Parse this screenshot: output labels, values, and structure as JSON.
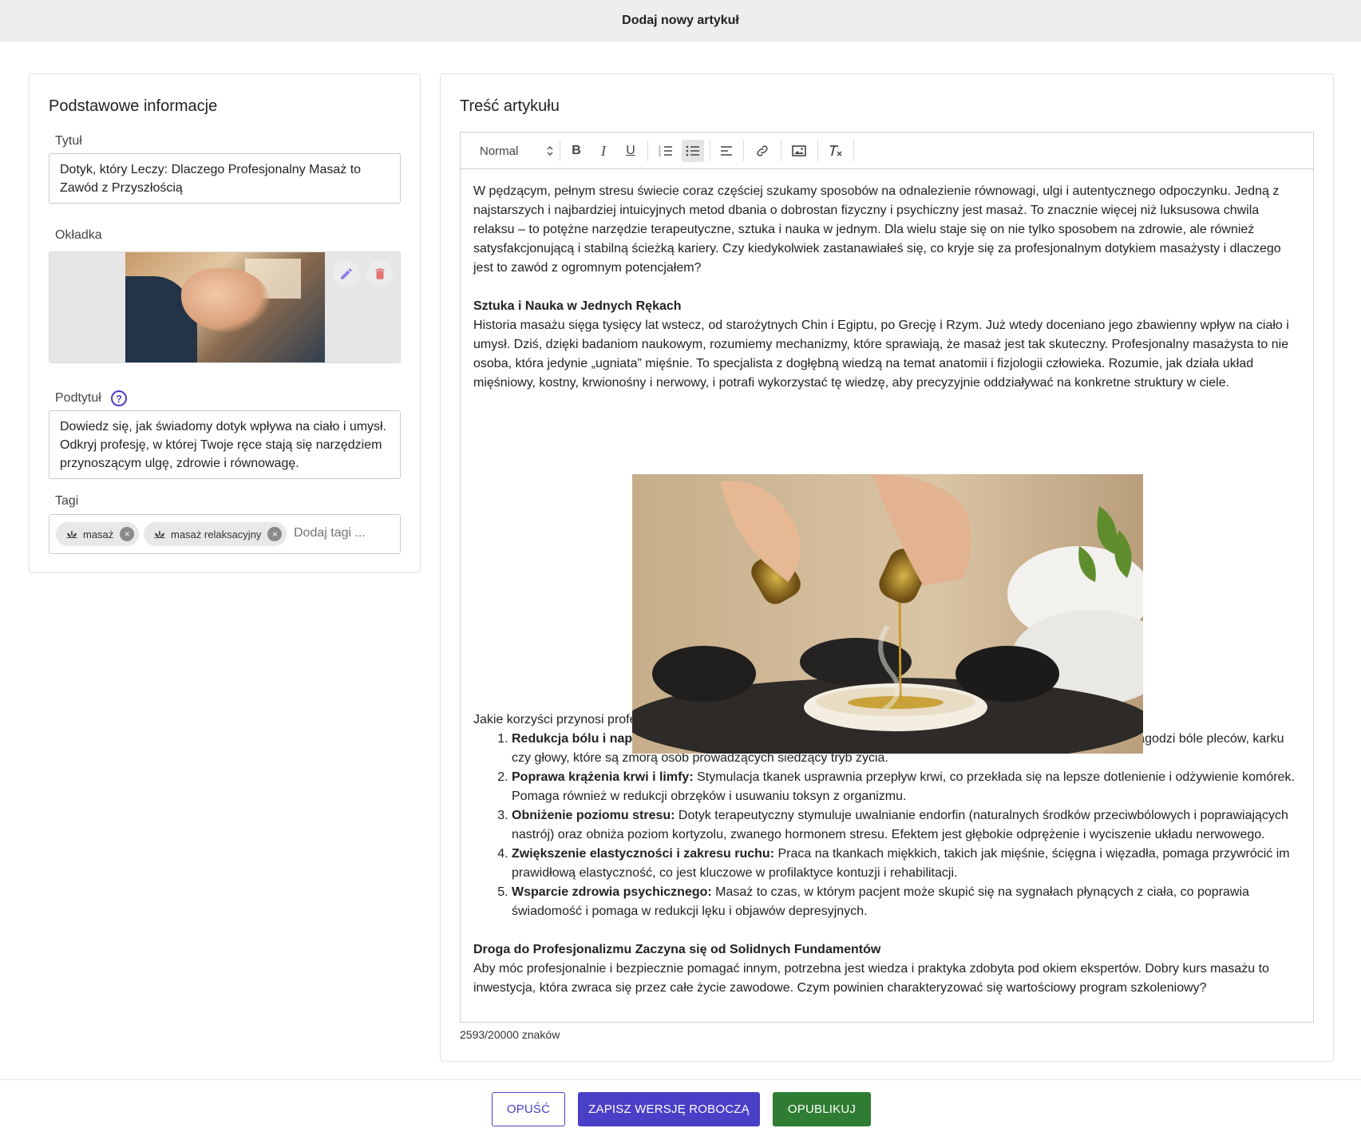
{
  "header": {
    "title": "Dodaj nowy artykuł"
  },
  "basic_info": {
    "section_title": "Podstawowe informacje",
    "title_label": "Tytuł",
    "title_value": "Dotyk, który Leczy: Dlaczego Profesjonalny Masaż to Zawód z Przyszłością",
    "cover_label": "Okładka",
    "cover_actions": {
      "edit_icon": "pencil-icon",
      "delete_icon": "trash-icon"
    },
    "subtitle_label": "Podtytuł",
    "subtitle_help_icon": "question-circle-icon",
    "subtitle_value": "Dowiedz się, jak świadomy dotyk wpływa na ciało i umysł. Odkryj profesję, w której Twoje ręce stają się narzędziem przynoszącym ulgę, zdrowie i równowagę.",
    "tags_label": "Tagi",
    "tags": [
      {
        "label": "masaż",
        "icon": "lotus-icon"
      },
      {
        "label": "masaż relaksacyjny",
        "icon": "lotus-icon"
      }
    ],
    "tags_placeholder": "Dodaj tagi ..."
  },
  "article": {
    "section_title": "Treść artykułu",
    "toolbar": {
      "format_select": "Normal",
      "buttons": [
        "bold-icon",
        "italic-icon",
        "underline-icon",
        "ordered-list-icon",
        "bullet-list-icon",
        "align-icon",
        "link-icon",
        "image-icon",
        "clear-format-icon"
      ],
      "active_button": "bullet-list-icon",
      "bold_label": "B",
      "italic_label": "I",
      "underline_label": "U"
    },
    "intro": "W pędzącym, pełnym stresu świecie coraz częściej szukamy sposobów na odnalezienie równowagi, ulgi i autentycznego odpoczynku. Jedną z najstarszych i najbardziej intuicyjnych metod dbania o dobrostan fizyczny i psychiczny jest masaż. To znacznie więcej niż luksusowa chwila relaksu – to potężne narzędzie terapeutyczne, sztuka i nauka w jednym. Dla wielu staje się on nie tylko sposobem na zdrowie, ale również satysfakcjonującą i stabilną ścieżką kariery. Czy kiedykolwiek zastanawiałeś się, co kryje się za profesjonalnym dotykiem masażysty i dlaczego jest to zawód z ogromnym potencjałem?",
    "heading1": "Sztuka i Nauka w Jednych Rękach",
    "para1": "Historia masażu sięga tysięcy lat wstecz, od starożytnych Chin i Egiptu, po Grecję i Rzym. Już wtedy doceniano jego zbawienny wpływ na ciało i umysł. Dziś, dzięki badaniom naukowym, rozumiemy mechanizmy, które sprawiają, że masaż jest tak skuteczny. Profesjonalny masażysta to nie osoba, która jedynie „ugniata” mięśnie. To specjalista z dogłębną wiedzą na temat anatomii i fizjologii człowieka. Rozumie, jak działa układ mięśniowy, kostny, krwionośny i nerwowy, i potrafi wykorzystać tę wiedzę, aby precyzyjnie oddziaływać na konkretne struktury w ciele.",
    "benefits_intro": "Jakie korzyści przynosi profesjonalnie wykonany masaż?",
    "benefits": [
      {
        "title": "Redukcja bólu i napięcia mięśniowego:",
        "text": " Poprzez rozluźnianie przykurczonych włókien mięśniowych, masaż łagodzi bóle pleców, karku czy głowy, które są zmorą osób prowadzących siedzący tryb życia."
      },
      {
        "title": "Poprawa krążenia krwi i limfy:",
        "text": " Stymulacja tkanek usprawnia przepływ krwi, co przekłada się na lepsze dotlenienie i odżywienie komórek. Pomaga również w redukcji obrzęków i usuwaniu toksyn z organizmu."
      },
      {
        "title": "Obniżenie poziomu stresu:",
        "text": " Dotyk terapeutyczny stymuluje uwalnianie endorfin (naturalnych środków przeciwbólowych i poprawiających nastrój) oraz obniża poziom kortyzolu, zwanego hormonem stresu. Efektem jest głębokie odprężenie i wyciszenie układu nerwowego."
      },
      {
        "title": "Zwiększenie elastyczności i zakresu ruchu:",
        "text": " Praca na tkankach miękkich, takich jak mięśnie, ścięgna i więzadła, pomaga przywrócić im prawidłową elastyczność, co jest kluczowe w profilaktyce kontuzji i rehabilitacji."
      },
      {
        "title": "Wsparcie zdrowia psychicznego:",
        "text": " Masaż to czas, w którym pacjent może skupić się na sygnałach płynących z ciała, co poprawia świadomość i pomaga w redukcji lęku i objawów depresyjnych."
      }
    ],
    "heading2": "Droga do Profesjonalizmu Zaczyna się od Solidnych Fundamentów",
    "para2": "Aby móc profesjonalnie i bezpiecznie pomagać innym, potrzebna jest wiedza i praktyka zdobyta pod okiem ekspertów. Dobry kurs masażu to inwestycja, która zwraca się przez całe życie zawodowe. Czym powinien charakteryzować się wartościowy program szkoleniowy?",
    "char_counter": "2593/20000 znaków"
  },
  "footer": {
    "cancel_label": "OPUŚĆ",
    "draft_label": "ZAPISZ WERSJĘ ROBOCZĄ",
    "publish_label": "OPUBLIKUJ"
  },
  "colors": {
    "primary": "#4a3fc7",
    "success": "#2e7d32",
    "danger": "#e57373"
  }
}
